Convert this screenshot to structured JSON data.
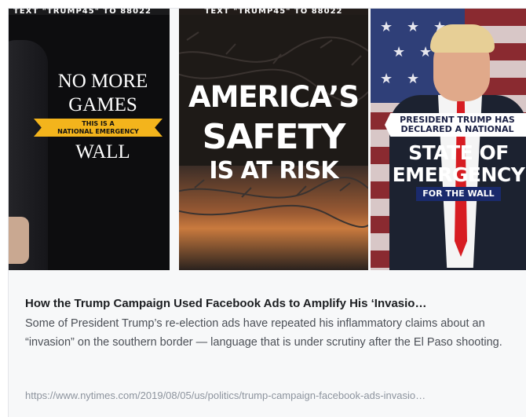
{
  "card": {
    "title": "How the Trump Campaign Used Facebook Ads to Amplify His ‘Invasio…",
    "description": "Some of President Trump’s re-election ads have repeated his inflammatory claims about an “invasion” on the southern border — language that is under scrutiny after the El Paso shooting.",
    "url": "https://www.nytimes.com/2019/08/05/us/politics/trump-campaign-facebook-ads-invasio…"
  },
  "ad1": {
    "topbar": "TEXT \"TRUMP45\" TO 88022",
    "line1": "NO MORE",
    "line2": "GAMES",
    "ribbon_line1": "THIS IS A",
    "ribbon_line2": "NATIONAL EMERGENCY",
    "line3": "WALL"
  },
  "ad2": {
    "topbar": "TEXT \"TRUMP45\" TO 88022",
    "line1": "AMERICA’S",
    "line2": "SAFETY",
    "line3": "IS AT RISK"
  },
  "ad3": {
    "banner_line1": "PRESIDENT TRUMP HAS",
    "banner_line2": "DECLARED A NATIONAL",
    "line1": "STATE OF",
    "line2": "EMERGENCY",
    "banner2": "FOR THE WALL"
  },
  "colors": {
    "ribbon": "#f3b41c",
    "title": "#1c1e21",
    "description": "#4b4f56",
    "url": "#8d949e",
    "card_bg": "#f7f8f9"
  }
}
